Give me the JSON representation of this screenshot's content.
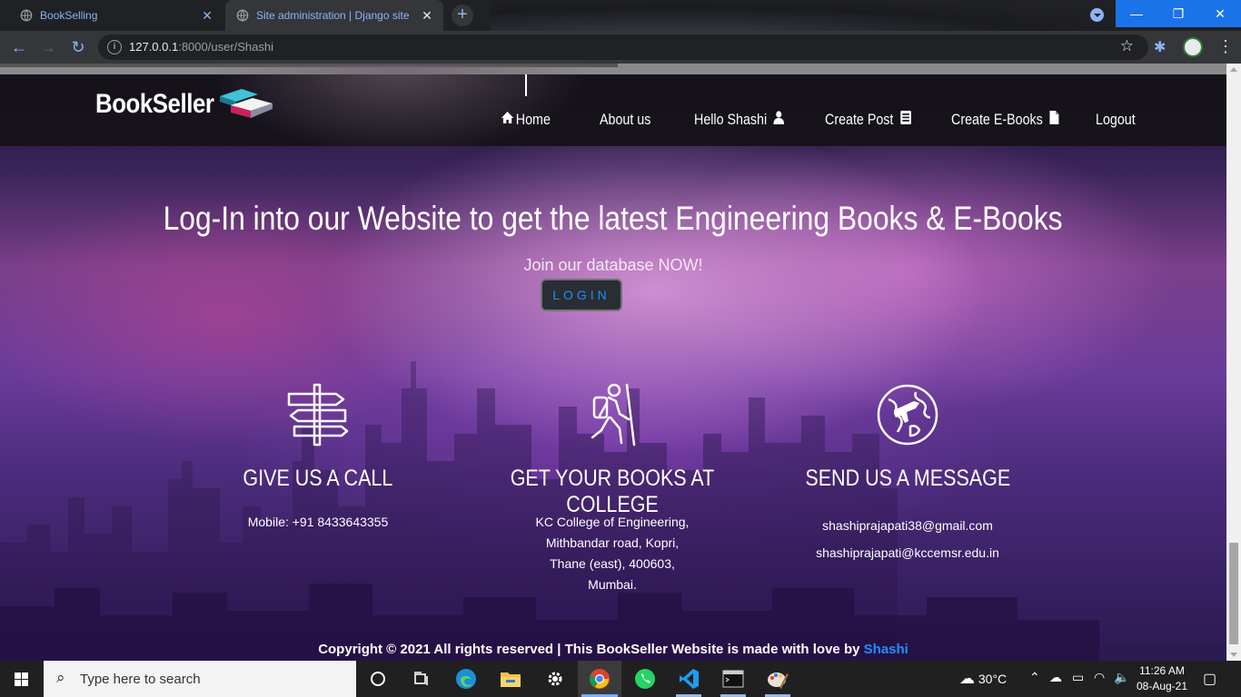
{
  "browser": {
    "tabs": [
      {
        "title": "BookSelling",
        "active": false
      },
      {
        "title": "Site administration | Django site admin",
        "active": true
      }
    ],
    "new_tab": "+",
    "url_host": "127.0.0.1",
    "url_path": ":8000/user/Shashi",
    "window_buttons": {
      "minimize": "—",
      "maximize": "❐",
      "close": "✕"
    }
  },
  "site": {
    "brand": "BookSeller",
    "nav": [
      {
        "label": "Home",
        "icon": "home-icon"
      },
      {
        "label": "About us",
        "icon": ""
      },
      {
        "label": "Hello Shashi",
        "icon": "user-icon"
      },
      {
        "label": "Create Post",
        "icon": "newspaper-icon"
      },
      {
        "label": "Create E-Books",
        "icon": "file-icon"
      },
      {
        "label": "Logout",
        "icon": ""
      }
    ],
    "hero": {
      "title": "Log-In into our Website to get the latest Engineering Books & E-Books",
      "subtitle": "Join our database NOW!",
      "button": "LOGIN"
    },
    "columns": [
      {
        "icon": "signpost-icon",
        "heading": "GIVE US A CALL",
        "lines": [
          "Mobile: +91 8433643355"
        ]
      },
      {
        "icon": "hiker-icon",
        "heading": "GET YOUR BOOKS AT COLLEGE",
        "lines": [
          "KC College of Engineering,",
          "Mithbandar road, Kopri,",
          "Thane (east), 400603,",
          "Mumbai."
        ]
      },
      {
        "icon": "globe-plane-icon",
        "heading": "SEND US A MESSAGE",
        "lines": [
          "shashiprajapati38@gmail.com",
          "shashiprajapati@kccemsr.edu.in"
        ]
      }
    ],
    "footer": {
      "text": "Copyright © 2021 All rights reserved | This BookSeller Website is made with love by",
      "author": "Shashi"
    }
  },
  "taskbar": {
    "search_placeholder": "Type here to search",
    "weather": "30°C",
    "time": "11:26 AM",
    "date": "08-Aug-21",
    "apps": [
      "cortana-icon",
      "task-view-icon",
      "edge-icon",
      "file-explorer-icon",
      "settings-icon",
      "chrome-icon",
      "whatsapp-icon",
      "vscode-icon",
      "terminal-icon",
      "paint-icon"
    ]
  },
  "colors": {
    "accent": "#1e90ff",
    "chrome_bg": "#202124",
    "toolbar_bg": "#35363a",
    "taskbar_bg": "#202020"
  }
}
